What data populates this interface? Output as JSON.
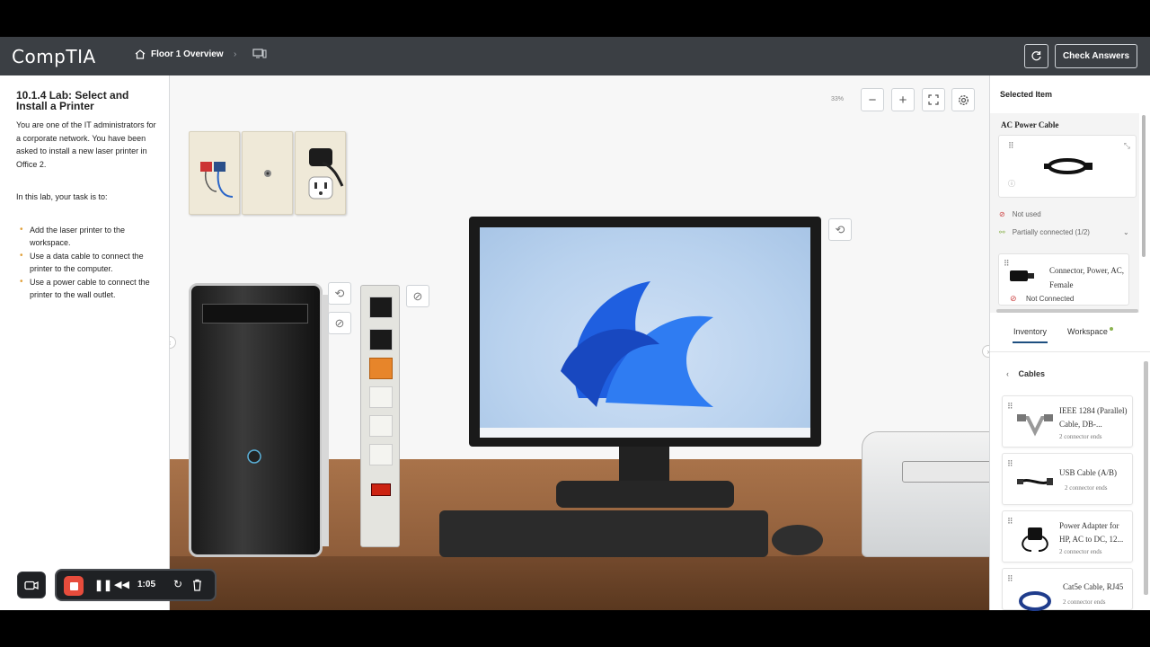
{
  "header": {
    "logo": "CompTIA",
    "breadcrumb": "Floor 1 Overview",
    "check_answers": "Check Answers"
  },
  "lab": {
    "title": "10.1.4 Lab: Select and Install a Printer",
    "intro": "You are one of the IT administrators for a corporate network. You have been asked to install a new laser printer in Office 2.",
    "task_lead": "In this lab, your task is to:",
    "tasks": [
      "Add the laser printer to the workspace.",
      "Use a data cable to connect the printer to the computer.",
      "Use a power cable to connect the printer to the wall outlet."
    ]
  },
  "workspace": {
    "zoom": "33%"
  },
  "selected": {
    "heading": "Selected Item",
    "item_name": "AC Power Cable",
    "status_used": "Not used",
    "status_connected": "Partially connected (1/2)",
    "connector_name": "Connector, Power, AC, Female",
    "connector_status": "Not Connected"
  },
  "tabs": {
    "inventory": "Inventory",
    "workspace": "Workspace"
  },
  "inventory": {
    "category": "Cables",
    "items": [
      {
        "name": "IEEE 1284 (Parallel) Cable, DB-...",
        "ends": "2 connector ends"
      },
      {
        "name": "USB Cable (A/B)",
        "ends": "2 connector ends"
      },
      {
        "name": "Power Adapter for HP, AC to DC, 12...",
        "ends": "2 connector ends"
      },
      {
        "name": "Cat5e Cable, RJ45",
        "ends": "2 connector ends"
      }
    ]
  },
  "recorder": {
    "time": "1:05"
  },
  "colors": {
    "header_bg": "#3b3f44",
    "accent_tab": "#1e4f80",
    "record_red": "#e74c3c",
    "bullet": "#e0a03a"
  }
}
